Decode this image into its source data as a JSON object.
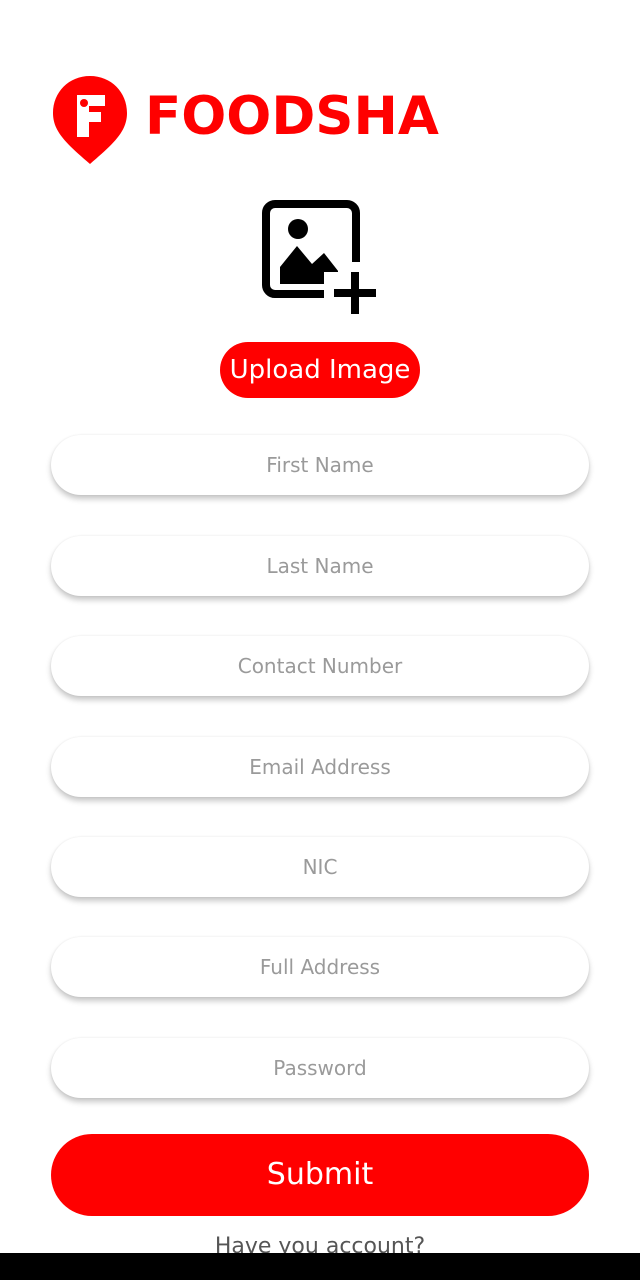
{
  "brand": {
    "name": "FOODSHA",
    "color": "#ff0000",
    "logo_icon": "location-pin-f-icon"
  },
  "upload": {
    "icon": "add-image-icon",
    "button_label": "Upload Image"
  },
  "form": {
    "first_name_placeholder": "First Name",
    "last_name_placeholder": "Last Name",
    "contact_number_placeholder": "Contact Number",
    "email_placeholder": "Email Address",
    "nic_placeholder": "NIC",
    "full_address_placeholder": "Full Address",
    "password_placeholder": "Password",
    "submit_label": "Submit"
  },
  "footer": {
    "have_account_text": "Have you account?"
  }
}
